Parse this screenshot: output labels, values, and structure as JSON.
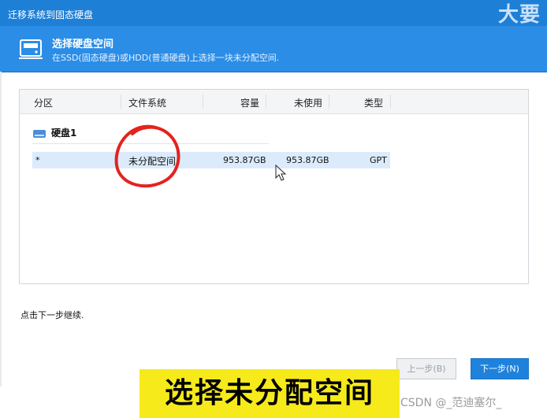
{
  "window": {
    "title": "迁移系统到固态硬盘",
    "brand": "大要"
  },
  "banner": {
    "heading": "选择硬盘空间",
    "subtitle": "在SSD(固态硬盘)或HDD(普通硬盘)上选择一块未分配空间."
  },
  "table": {
    "columns": [
      "分区",
      "文件系统",
      "容量",
      "未使用",
      "类型"
    ],
    "disk_label": "硬盘1",
    "row": {
      "partition": "*",
      "filesystem": "未分配空间",
      "capacity": "953.87GB",
      "unused": "953.87GB",
      "type": "GPT"
    }
  },
  "hint": "点击下一步继续.",
  "buttons": {
    "prev": "上一步(B)",
    "next": "下一步(N)"
  },
  "caption": "选择未分配空间",
  "watermark": "CSDN @_范迪塞尔_",
  "colors": {
    "titlebar": "#1e7fd6",
    "banner": "#2b8de6",
    "selected_row": "#dcebfb",
    "annotation": "#e3231f",
    "caption_bg": "#f6ea1b"
  }
}
